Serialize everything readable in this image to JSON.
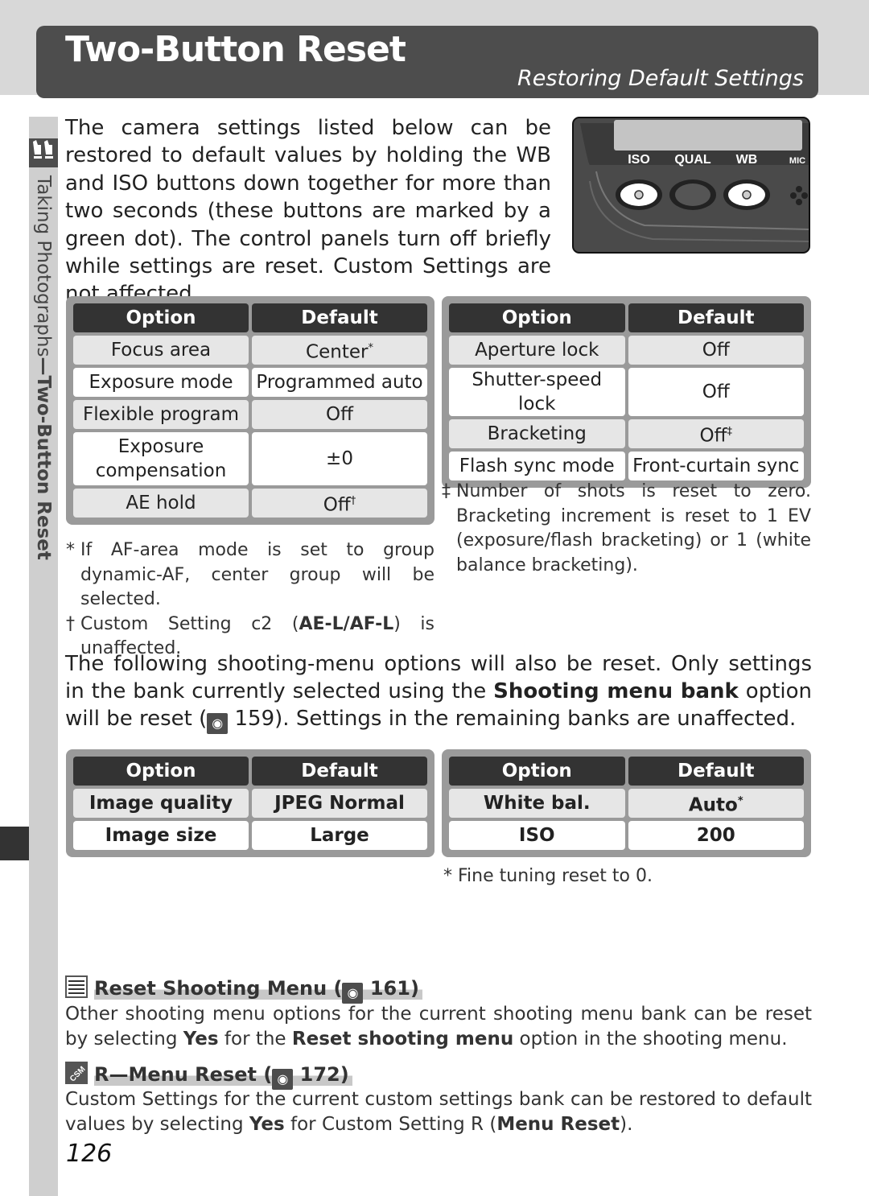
{
  "header": {
    "title": "Two-Button Reset",
    "subtitle": "Restoring Default Settings"
  },
  "sidebar": {
    "section_label": "Taking Photographs",
    "dash": "—",
    "page_label": "Two-Button Reset",
    "icon": "taking-photographs-icon"
  },
  "intro": {
    "text_1": "The camera settings listed below can be restored to default values by holding the ",
    "wb": "WB",
    "and": " and ",
    "iso": "ISO",
    "text_2": " buttons down together for more than two seconds (these buttons are marked by a green dot).  The control panels turn off briefly while settings are reset.  Custom Settings are not affected."
  },
  "control_panel": {
    "labels": [
      "ISO",
      "QUAL",
      "WB",
      "MIC"
    ]
  },
  "table1": {
    "headers": [
      "Option",
      "Default"
    ],
    "rows": [
      {
        "option": "Focus area",
        "default": "Center",
        "mark": "*"
      },
      {
        "option": "Exposure mode",
        "default": "Programmed auto",
        "mark": ""
      },
      {
        "option": "Flexible program",
        "default": "Off",
        "mark": ""
      },
      {
        "option": "Exposure compensation",
        "option_line1": "Exposure",
        "option_line2": "compensation",
        "default": "±0",
        "mark": ""
      },
      {
        "option": "AE hold",
        "default": "Off",
        "mark": "†"
      }
    ]
  },
  "table2": {
    "headers": [
      "Option",
      "Default"
    ],
    "rows": [
      {
        "option": "Aperture lock",
        "default": "Off",
        "mark": ""
      },
      {
        "option": "Shutter-speed lock",
        "default": "Off",
        "mark": ""
      },
      {
        "option": "Bracketing",
        "default": "Off",
        "mark": "‡"
      },
      {
        "option": "Flash sync mode",
        "default": "Front-curtain sync",
        "mark": ""
      }
    ]
  },
  "notes1": [
    {
      "mark": "*",
      "text": "If AF-area mode is set to group dynamic-AF, center group will be selected."
    },
    {
      "mark": "†",
      "text_1": "Custom Setting c2 (",
      "bold": "AE-L/AF-L",
      "text_2": ") is unaffected."
    }
  ],
  "notes2": [
    {
      "mark": "‡",
      "text": "Number of shots is reset to zero. Bracketing increment is reset to 1 EV (exposure/flash bracketing) or 1 (white balance bracketing)."
    }
  ],
  "para2": {
    "text_1": "The following shooting-menu options will also be reset.  Only settings in the bank currently selected using the ",
    "bold": "Shooting menu bank",
    "text_2": " option will be reset (",
    "ref": "159",
    "text_3": ").  Settings in the remaining banks are unaffected."
  },
  "table3": {
    "headers": [
      "Option",
      "Default"
    ],
    "rows": [
      {
        "option": "Image quality",
        "default": "JPEG Normal",
        "mark": ""
      },
      {
        "option": "Image size",
        "default": "Large",
        "mark": ""
      }
    ]
  },
  "table4": {
    "headers": [
      "Option",
      "Default"
    ],
    "rows": [
      {
        "option": "White bal.",
        "default": "Auto",
        "mark": "*"
      },
      {
        "option": "ISO",
        "default": "200",
        "mark": ""
      }
    ]
  },
  "note4": {
    "mark": "*",
    "text": "Fine tuning reset to 0."
  },
  "section1": {
    "icon": "shooting-menu-icon",
    "title": "Reset Shooting Menu (",
    "ref": "161",
    "close": ")",
    "body_1": "Other shooting menu options for the current shooting menu bank can be reset by selecting ",
    "yes": "Yes",
    "body_2": " for the ",
    "bold": "Reset shooting menu",
    "body_3": " option in the shooting menu."
  },
  "section2": {
    "icon": "csm-icon",
    "icon_label": "CSM",
    "title": "R—Menu Reset (",
    "ref": "172",
    "close": ")",
    "body_1": "Custom Settings for the current custom settings bank can be restored to default values by selecting ",
    "yes": "Yes",
    "body_2": " for Custom Setting R (",
    "bold": "Menu Reset",
    "body_3": ")."
  },
  "page_number": "126"
}
